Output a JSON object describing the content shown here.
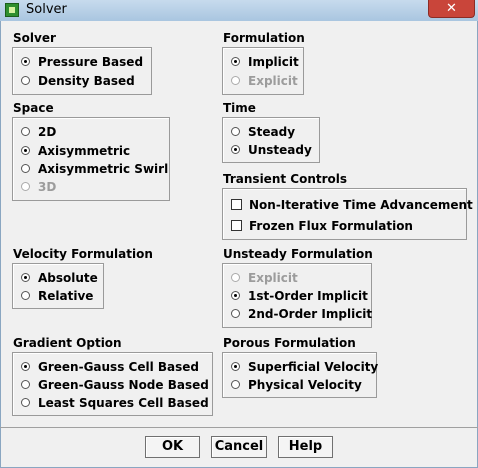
{
  "window": {
    "title": "Solver",
    "close_glyph": "✕"
  },
  "solver": {
    "label": "Solver",
    "options": [
      {
        "label": "Pressure Based",
        "selected": true,
        "disabled": false
      },
      {
        "label": "Density Based",
        "selected": false,
        "disabled": false
      }
    ]
  },
  "space": {
    "label": "Space",
    "options": [
      {
        "label": "2D",
        "selected": false,
        "disabled": false
      },
      {
        "label": "Axisymmetric",
        "selected": true,
        "disabled": false
      },
      {
        "label": "Axisymmetric Swirl",
        "selected": false,
        "disabled": false
      },
      {
        "label": "3D",
        "selected": false,
        "disabled": true
      }
    ]
  },
  "velocity_formulation": {
    "label": "Velocity Formulation",
    "options": [
      {
        "label": "Absolute",
        "selected": true,
        "disabled": false
      },
      {
        "label": "Relative",
        "selected": false,
        "disabled": false
      }
    ]
  },
  "gradient_option": {
    "label": "Gradient Option",
    "options": [
      {
        "label": "Green-Gauss Cell Based",
        "selected": true,
        "disabled": false
      },
      {
        "label": "Green-Gauss Node Based",
        "selected": false,
        "disabled": false
      },
      {
        "label": "Least Squares Cell Based",
        "selected": false,
        "disabled": false
      }
    ]
  },
  "formulation": {
    "label": "Formulation",
    "options": [
      {
        "label": "Implicit",
        "selected": true,
        "disabled": false
      },
      {
        "label": "Explicit",
        "selected": false,
        "disabled": true
      }
    ]
  },
  "time": {
    "label": "Time",
    "options": [
      {
        "label": "Steady",
        "selected": false,
        "disabled": false
      },
      {
        "label": "Unsteady",
        "selected": true,
        "disabled": false
      }
    ]
  },
  "transient_controls": {
    "label": "Transient Controls",
    "checks": [
      {
        "label": "Non-Iterative Time Advancement",
        "checked": false
      },
      {
        "label": "Frozen Flux Formulation",
        "checked": false
      }
    ]
  },
  "unsteady_formulation": {
    "label": "Unsteady Formulation",
    "options": [
      {
        "label": "Explicit",
        "selected": false,
        "disabled": true
      },
      {
        "label": "1st-Order Implicit",
        "selected": true,
        "disabled": false
      },
      {
        "label": "2nd-Order Implicit",
        "selected": false,
        "disabled": false
      }
    ]
  },
  "porous_formulation": {
    "label": "Porous Formulation",
    "options": [
      {
        "label": "Superficial Velocity",
        "selected": true,
        "disabled": false
      },
      {
        "label": "Physical Velocity",
        "selected": false,
        "disabled": false
      }
    ]
  },
  "buttons": {
    "ok": "OK",
    "cancel": "Cancel",
    "help": "Help"
  },
  "icons": {
    "app": "fluent-app-icon",
    "close": "close-icon"
  }
}
